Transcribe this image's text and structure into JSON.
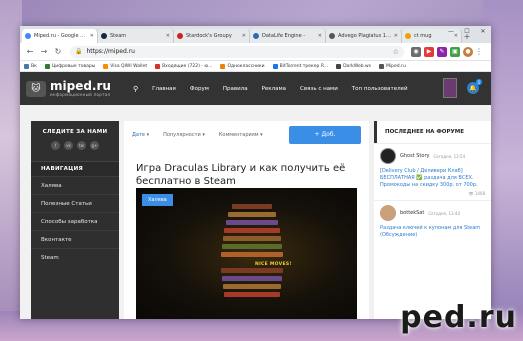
{
  "browser": {
    "tabs": [
      {
        "label": "Miped.ru - Google Chr",
        "color": "#4285f4",
        "active": true
      },
      {
        "label": "Steam",
        "color": "#1b2838"
      },
      {
        "label": "Stardock's Groupy",
        "color": "#cc2222"
      },
      {
        "label": "DataLife Engine - ",
        "color": "#2a6db5"
      },
      {
        "label": "Advego Plagiatus 1.3.5.2",
        "color": "#555555"
      },
      {
        "label": "ct mug",
        "color": "#f0a000"
      }
    ],
    "url": "https://miped.ru",
    "bookmarks": [
      {
        "label": "Вк",
        "color": "#4a76a8"
      },
      {
        "label": "Цифровые товары",
        "color": "#2e7d32"
      },
      {
        "label": "Visa QIWI Wallet",
        "color": "#ff8c00"
      },
      {
        "label": "Входящие (722) - ю...",
        "color": "#d93025"
      },
      {
        "label": "Одноклассники",
        "color": "#ee8208"
      },
      {
        "label": "BitTorrent трекер R...",
        "color": "#1a73e8"
      },
      {
        "label": "DarkWeb.ws",
        "color": "#444444"
      },
      {
        "label": "Miped.ru",
        "color": "#555555"
      }
    ]
  },
  "site": {
    "logo_name": "miped.ru",
    "logo_tagline": "информационный портал",
    "nav": [
      "Главная",
      "Форум",
      "Правила",
      "Реклама",
      "Связь с нами",
      "Топ пользователей"
    ],
    "notif_count": "1",
    "sidebar": {
      "follow_title": "СЛЕДИТЕ ЗА НАМИ",
      "social": [
        "f",
        "vk",
        "tw",
        "g+"
      ],
      "nav_title": "НАВИГАЦИЯ",
      "items": [
        "Халява",
        "Полезные Статьи",
        "Способы заработка",
        "Вконтакте",
        "Steam"
      ]
    },
    "filters": [
      {
        "label": "Дате",
        "arrow": "▾"
      },
      {
        "label": "Популярности",
        "arrow": "▾"
      },
      {
        "label": "Комментариям",
        "arrow": "▾"
      }
    ],
    "add_button": "+ Доб.",
    "article": {
      "title": "Игра Draculas Library и как получить её бесплатно в Steam",
      "badge": "Халява",
      "game_caption": "NICE MOVES!"
    },
    "forum": {
      "title": "ПОСЛЕДНЕЕ НА ФОРУМЕ",
      "posts": [
        {
          "user": "Ghost Story",
          "time": "Сегодня, 13:54",
          "text": "[Delivery Club / Деливери Клаб] БЕСПЛАТНАЯ ✅ раздача для ВСЕХ. Промокоды на скидку 300р. от 700р.",
          "views": "1408"
        },
        {
          "user": "bottekSat",
          "time": "Сегодня, 13:44",
          "text": "Раздача ключей к купонам для Steam (Обсуждение)",
          "views": ""
        }
      ]
    }
  },
  "watermark": "ped.ru"
}
